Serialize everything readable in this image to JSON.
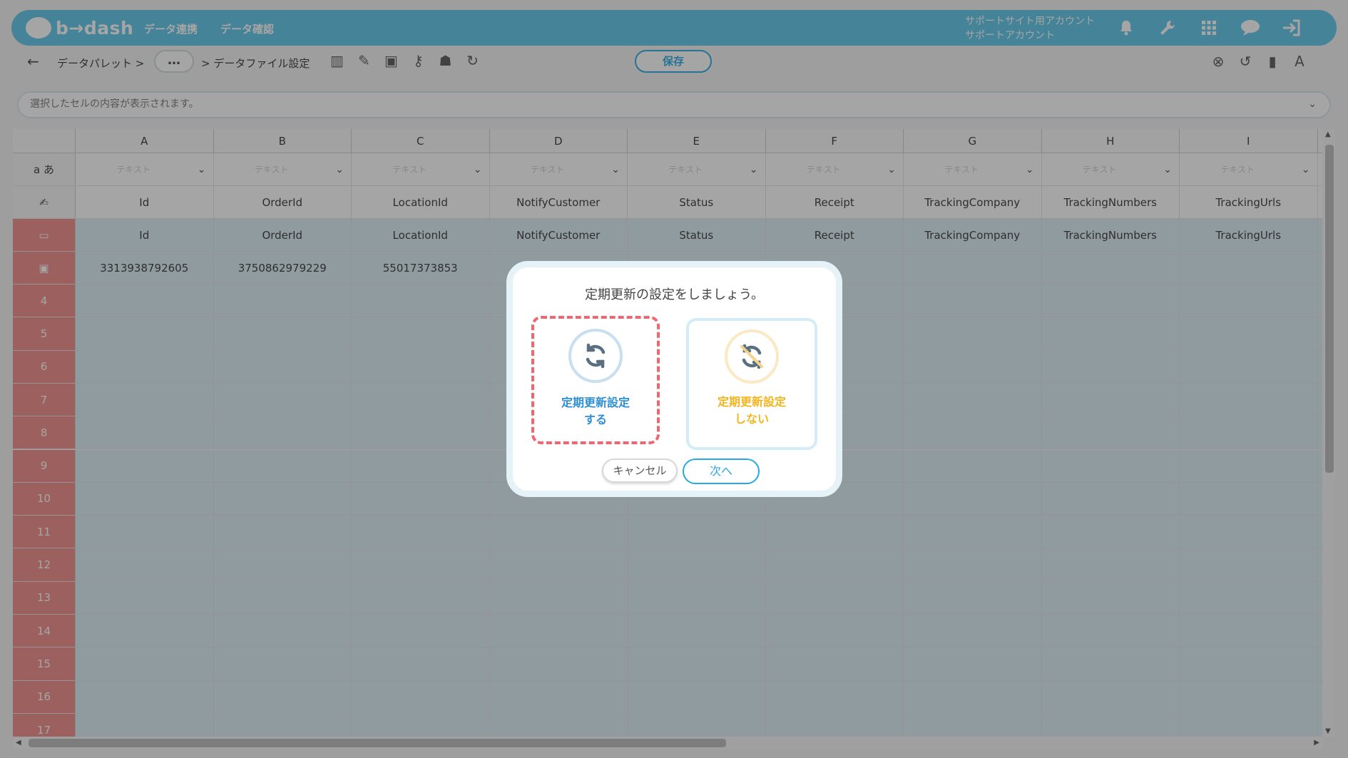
{
  "header": {
    "logo_text": "b→dash",
    "nav": [
      "データ連携",
      "データ確認"
    ],
    "account_line1": "サポートサイト用アカウント",
    "account_line2": "サポートアカウント",
    "icons": [
      "bell-icon",
      "wrench-icon",
      "apps-grid-icon",
      "chat-bubble-icon",
      "logout-icon"
    ]
  },
  "toolbar": {
    "breadcrumb_root": "データパレット >",
    "more_label": "…",
    "breadcrumb_current": "> データファイル設定",
    "save_label": "保存",
    "tool_icons": [
      "columns-icon",
      "edit-icon",
      "formula-icon",
      "key-icon",
      "users-icon",
      "refresh-icon"
    ],
    "right_icons": [
      "close-circle-icon",
      "history-icon",
      "document-icon",
      "font-icon"
    ]
  },
  "cell_input": {
    "placeholder": "選択したセルの内容が表示されます。"
  },
  "grid": {
    "columns": [
      "A",
      "B",
      "C",
      "D",
      "E",
      "F",
      "G",
      "H",
      "I"
    ],
    "type_header": "a あ",
    "type_placeholder": "テキスト",
    "display_names": [
      "Id",
      "OrderId",
      "LocationId",
      "NotifyCustomer",
      "Status",
      "Receipt",
      "TrackingCompany",
      "TrackingNumbers",
      "TrackingUrls"
    ],
    "physical_names": [
      "Id",
      "OrderId",
      "LocationId",
      "NotifyCustomer",
      "Status",
      "Receipt",
      "TrackingCompany",
      "TrackingNumbers",
      "TrackingUrls"
    ],
    "sample_row": [
      "3313938792605",
      "3750862979229",
      "55017373853",
      "",
      "",
      "",
      "",
      "",
      ""
    ],
    "row_numbers": [
      "4",
      "5",
      "6",
      "7",
      "8",
      "9",
      "10",
      "11",
      "12",
      "13",
      "14",
      "15",
      "16",
      "17"
    ]
  },
  "modal": {
    "title": "定期更新の設定をしましょう。",
    "option_yes_line1": "定期更新設定",
    "option_yes_line2": "する",
    "option_no_line1": "定期更新設定",
    "option_no_line2": "しない",
    "cancel_label": "キャンセル",
    "next_label": "次へ"
  },
  "colors": {
    "header_bg": "#5bc5e9",
    "accent": "#27a9e1",
    "row_header_bg": "#f08a86",
    "selected_row_bg": "#dbeef7",
    "option_yes_text": "#2f8fd4",
    "option_no_text": "#f3b51e",
    "highlight_dash": "#f0656e"
  }
}
